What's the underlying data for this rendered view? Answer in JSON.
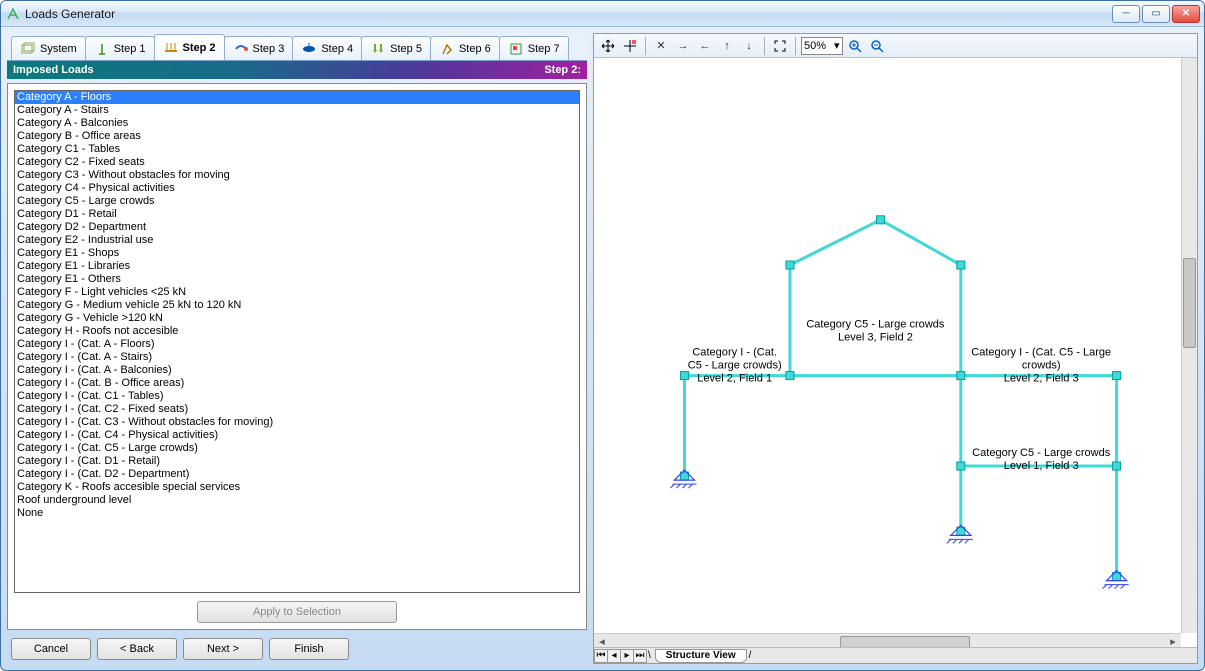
{
  "window": {
    "title": "Loads Generator"
  },
  "tabs": [
    {
      "label": "System"
    },
    {
      "label": "Step 1"
    },
    {
      "label": "Step 2",
      "active": true
    },
    {
      "label": "Step 3"
    },
    {
      "label": "Step 4"
    },
    {
      "label": "Step 5"
    },
    {
      "label": "Step 6"
    },
    {
      "label": "Step 7"
    }
  ],
  "header": {
    "title": "Imposed Loads",
    "step": "Step 2:"
  },
  "categories": [
    "Category A - Floors",
    "Category A - Stairs",
    "Category A - Balconies",
    "Category B - Office areas",
    "Category C1 - Tables",
    "Category C2 - Fixed seats",
    "Category C3 - Without obstacles for moving",
    "Category C4 - Physical activities",
    "Category C5 - Large crowds",
    "Category D1 - Retail",
    "Category D2 - Department",
    "Category E2 - Industrial use",
    "Category E1 - Shops",
    "Category E1 - Libraries",
    "Category E1 - Others",
    "Category F - Light vehicles <25 kN",
    "Category G - Medium vehicle 25 kN to 120 kN",
    "Category G - Vehicle >120 kN",
    "Category H - Roofs not accesible",
    "Category I - (Cat. A - Floors)",
    "Category I - (Cat. A - Stairs)",
    "Category I - (Cat. A - Balconies)",
    "Category I - (Cat. B - Office areas)",
    "Category I - (Cat. C1 - Tables)",
    "Category I - (Cat. C2 - Fixed seats)",
    "Category I - (Cat. C3 - Without obstacles for moving)",
    "Category I - (Cat. C4 - Physical activities)",
    "Category I - (Cat. C5 - Large crowds)",
    "Category I - (Cat. D1 - Retail)",
    "Category I - (Cat. D2 - Department)",
    "Category K - Roofs accesible special services",
    "Roof underground level",
    "None"
  ],
  "selected_index": 0,
  "buttons": {
    "apply": "Apply to Selection",
    "cancel": "Cancel",
    "back": "< Back",
    "next": "Next >",
    "finish": "Finish"
  },
  "viewer": {
    "zoom": "50%",
    "sheet_tab": "Structure  View"
  },
  "structure_labels": {
    "l3f2a": "Category C5 - Large crowds",
    "l3f2b": "Level 3, Field 2",
    "l2f1a": "Category I - (Cat.",
    "l2f1b": "C5 - Large crowds)",
    "l2f1c": "Level 2, Field 1",
    "l2f3a": "Category I - (Cat. C5 - Large",
    "l2f3b": "crowds)",
    "l2f3c": "Level 2, Field 3",
    "l1f3a": "Category C5 - Large crowds",
    "l1f3b": "Level 1, Field 3"
  }
}
